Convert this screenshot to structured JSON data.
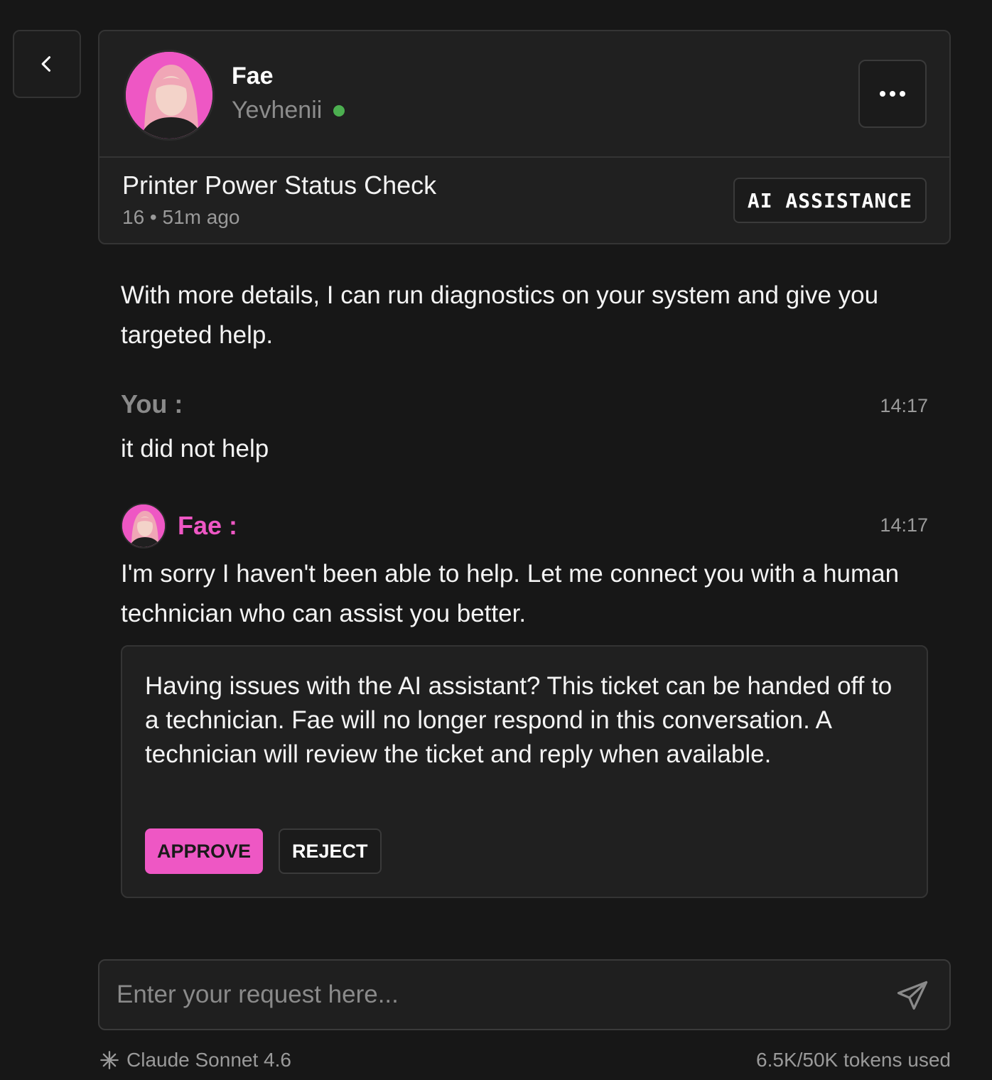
{
  "header": {
    "agent_name": "Fae",
    "user_name": "Yevhenii",
    "ticket_title": "Printer Power Status Check",
    "ticket_meta": "16 • 51m ago",
    "badge": "AI ASSISTANCE"
  },
  "messages": {
    "intro_text": "With more details, I can run diagnostics on your system and give you targeted help.",
    "you_label": "You :",
    "you_time": "14:17",
    "you_text": "it did not help",
    "fae_label": "Fae :",
    "fae_time": "14:17",
    "fae_text": "I'm sorry I haven't been able to help. Let me connect you with a human technician who can assist you better."
  },
  "handoff": {
    "text": "Having issues with the AI assistant? This ticket can be handed off to a technician. Fae will no longer respond in this conversation. A technician will review the ticket and reply when available.",
    "approve_label": "APPROVE",
    "reject_label": "REJECT"
  },
  "composer": {
    "placeholder": "Enter your request here..."
  },
  "footer": {
    "model": "Claude Sonnet 4.6",
    "tokens": "6.5K/50K tokens used"
  },
  "colors": {
    "accent": "#ee57c4",
    "online": "#4caf50",
    "background": "#171717"
  },
  "icons": [
    "back-chevron-icon",
    "more-dots-icon",
    "online-status-icon",
    "send-icon",
    "model-sparkle-icon"
  ]
}
